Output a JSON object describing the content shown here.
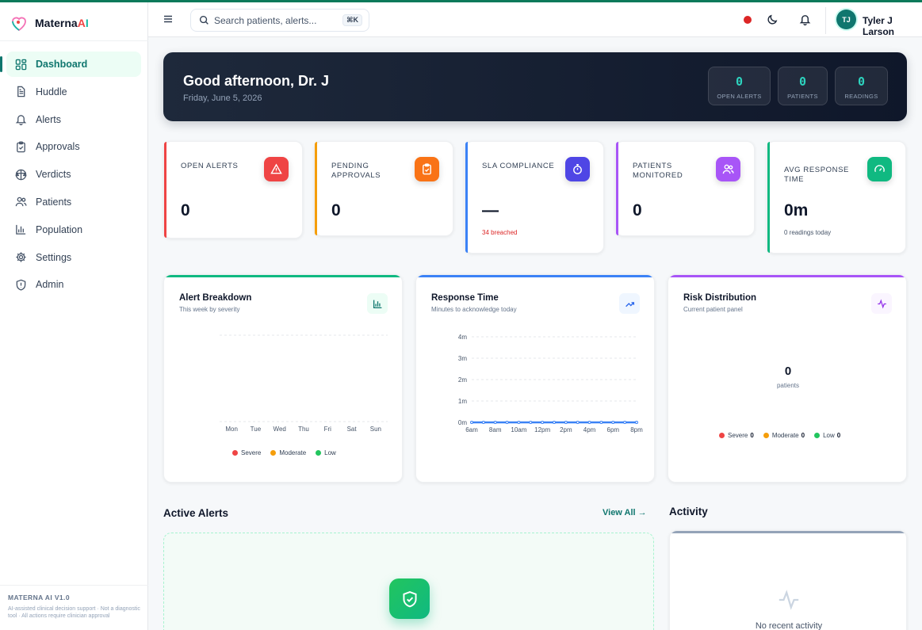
{
  "app": {
    "name_main": "Materna",
    "name_ai_a": "A",
    "name_ai_i": "I"
  },
  "sidebar": {
    "items": [
      {
        "label": "Dashboard",
        "icon": "grid-icon",
        "active": true
      },
      {
        "label": "Huddle",
        "icon": "document-icon"
      },
      {
        "label": "Alerts",
        "icon": "bell-icon"
      },
      {
        "label": "Approvals",
        "icon": "clipboard-check-icon"
      },
      {
        "label": "Verdicts",
        "icon": "scales-icon"
      },
      {
        "label": "Patients",
        "icon": "users-icon"
      },
      {
        "label": "Population",
        "icon": "bar-chart-icon"
      },
      {
        "label": "Settings",
        "icon": "gear-icon"
      },
      {
        "label": "Admin",
        "icon": "shield-icon"
      }
    ],
    "footer": {
      "title": "MATERNA AI V1.0",
      "text": "AI-assisted clinical decision support · Not a diagnostic tool · All actions require clinician approval"
    }
  },
  "header": {
    "search_placeholder": "Search patients, alerts...",
    "search_shortcut": "⌘K",
    "user_initials": "TJ",
    "user_name": "Tyler J Larson",
    "status_color": "#dc2626"
  },
  "hero": {
    "greeting": "Good afternoon, Dr. J",
    "date": "Friday, June 5, 2026",
    "stats": [
      {
        "value": "0",
        "label": "OPEN ALERTS"
      },
      {
        "value": "0",
        "label": "PATIENTS"
      },
      {
        "value": "0",
        "label": "READINGS"
      }
    ]
  },
  "kpis": [
    {
      "title": "OPEN ALERTS",
      "value": "0",
      "sub": "",
      "color": "#ef4444",
      "icon": "warning-icon"
    },
    {
      "title": "PENDING APPROVALS",
      "value": "0",
      "sub": "",
      "color": "#f59e0b",
      "icon": "clipboard-icon"
    },
    {
      "title": "SLA COMPLIANCE",
      "value": "—",
      "sub": "34 breached",
      "color": "#3b82f6",
      "icon": "stopwatch-icon"
    },
    {
      "title": "PATIENTS MONITORED",
      "value": "0",
      "sub": "",
      "color": "#a855f7",
      "icon": "users-icon"
    },
    {
      "title": "AVG RESPONSE TIME",
      "value": "0m",
      "sub": "0 readings today",
      "color": "#10b981",
      "icon": "gauge-icon"
    }
  ],
  "charts": {
    "alert_breakdown": {
      "title": "Alert Breakdown",
      "subtitle": "This week by severity",
      "icon": "bar-chart-icon"
    },
    "response_time": {
      "title": "Response Time",
      "subtitle": "Minutes to acknowledge today",
      "icon": "trending-up-icon"
    },
    "risk_distribution": {
      "title": "Risk Distribution",
      "subtitle": "Current patient panel",
      "icon": "activity-icon",
      "center_value": "0",
      "center_label": "patients"
    }
  },
  "chart_data": [
    {
      "type": "bar",
      "title": "Alert Breakdown",
      "categories": [
        "Mon",
        "Tue",
        "Wed",
        "Thu",
        "Fri",
        "Sat",
        "Sun"
      ],
      "series": [
        {
          "name": "Severe",
          "values": [
            0,
            0,
            0,
            0,
            0,
            0,
            0
          ],
          "color": "#ef4444"
        },
        {
          "name": "Moderate",
          "values": [
            0,
            0,
            0,
            0,
            0,
            0,
            0
          ],
          "color": "#f59e0b"
        },
        {
          "name": "Low",
          "values": [
            0,
            0,
            0,
            0,
            0,
            0,
            0
          ],
          "color": "#22c55e"
        }
      ],
      "grid": true
    },
    {
      "type": "line",
      "title": "Response Time",
      "x": [
        "6am",
        "7am",
        "8am",
        "9am",
        "10am",
        "11am",
        "12pm",
        "1pm",
        "2pm",
        "3pm",
        "4pm",
        "5pm",
        "6pm",
        "7pm",
        "8pm"
      ],
      "x_tick_labels": [
        "6am",
        "8am",
        "10am",
        "12pm",
        "2pm",
        "4pm",
        "6pm",
        "8pm"
      ],
      "y_tick_labels": [
        "0m",
        "1m",
        "2m",
        "3m",
        "4m"
      ],
      "ylim": [
        0,
        4
      ],
      "values": [
        0,
        0,
        0,
        0,
        0,
        0,
        0,
        0,
        0,
        0,
        0,
        0,
        0,
        0,
        0
      ],
      "color": "#3b82f6",
      "grid": true
    },
    {
      "type": "pie",
      "title": "Risk Distribution",
      "categories": [
        "Severe",
        "Moderate",
        "Low"
      ],
      "values": [
        0,
        0,
        0
      ],
      "colors": [
        "#ef4444",
        "#f59e0b",
        "#22c55e"
      ]
    }
  ],
  "bottom": {
    "active_alerts_title": "Active Alerts",
    "view_all": "View All",
    "activity_title": "Activity",
    "activity_empty": "No recent activity"
  }
}
